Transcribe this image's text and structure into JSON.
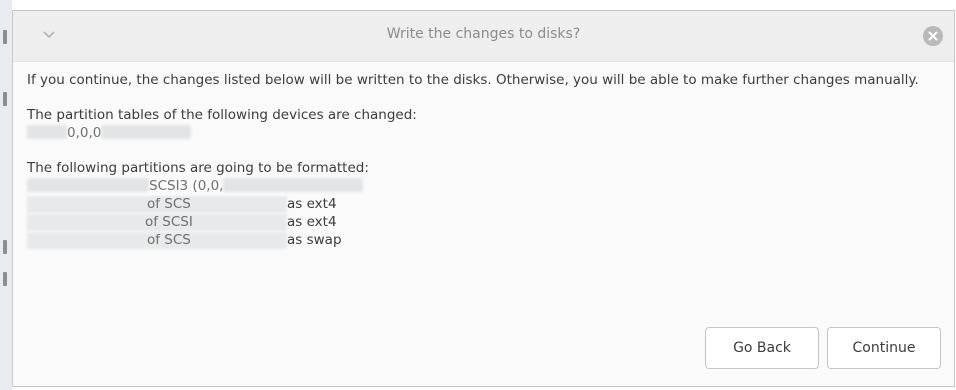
{
  "window": {
    "title": "Write the changes to disks?"
  },
  "message": {
    "intro": "If you continue, the changes listed below will be written to the disks. Otherwise, you will be able to make further changes manually.",
    "tables_heading": "The partition tables of the following devices are changed:",
    "tables_device": "0,0,0",
    "format_heading": "The following partitions are going to be formatted:",
    "format_device": "SCSI3 (0,0,",
    "partitions": [
      {
        "device_fragment": "of SCS",
        "filesystem": "as ext4"
      },
      {
        "device_fragment": "of SCSI",
        "filesystem": "as ext4"
      },
      {
        "device_fragment": "of SCS",
        "filesystem": "as swap"
      }
    ]
  },
  "buttons": {
    "back": "Go Back",
    "continue": "Continue"
  },
  "icons": {
    "menu": "chevron-down-icon",
    "close": "close-icon"
  }
}
